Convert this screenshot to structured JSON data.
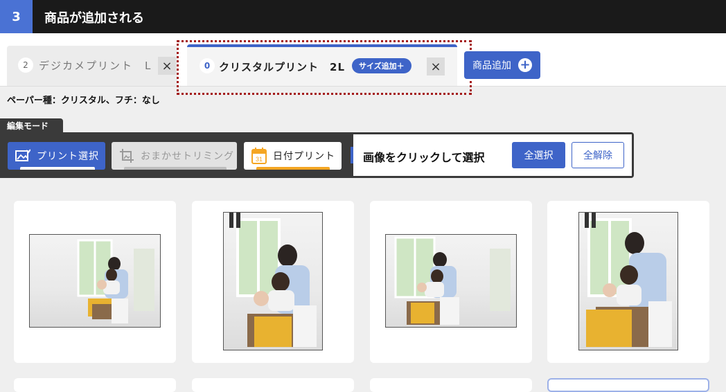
{
  "header": {
    "step": "3",
    "title": "商品が追加される"
  },
  "tabs": [
    {
      "count": "2",
      "label": "デジカメプリント　L",
      "close": "×"
    },
    {
      "count": "0",
      "label": "クリスタルプリント　2L",
      "size_add": "サイズ追加＋",
      "close": "×"
    }
  ],
  "add_product": {
    "label": "商品追加",
    "icon": "plus-circle-icon"
  },
  "paper_info": "ペーパー種：クリスタル、フチ：なし",
  "edit_mode": {
    "tag": "編集モード",
    "buttons": [
      {
        "label": "プリント選択",
        "icon": "image-select-icon",
        "active": true
      },
      {
        "label": "おまかせトリミング",
        "icon": "crop-icon",
        "active": false
      },
      {
        "label": "日付プリント",
        "icon": "calendar-icon",
        "calendar_day": "31",
        "active": false
      }
    ],
    "instruction": "画像をクリックして選択",
    "select_all": "全選択",
    "clear_all": "全解除"
  },
  "colors": {
    "accent": "#3e64c8",
    "header_bg": "#1a1a1a",
    "date_accent": "#f5a623",
    "highlight_border": "#a31818"
  },
  "photos": [
    {
      "orientation": "landscape"
    },
    {
      "orientation": "portrait"
    },
    {
      "orientation": "landscape"
    },
    {
      "orientation": "portrait"
    }
  ]
}
